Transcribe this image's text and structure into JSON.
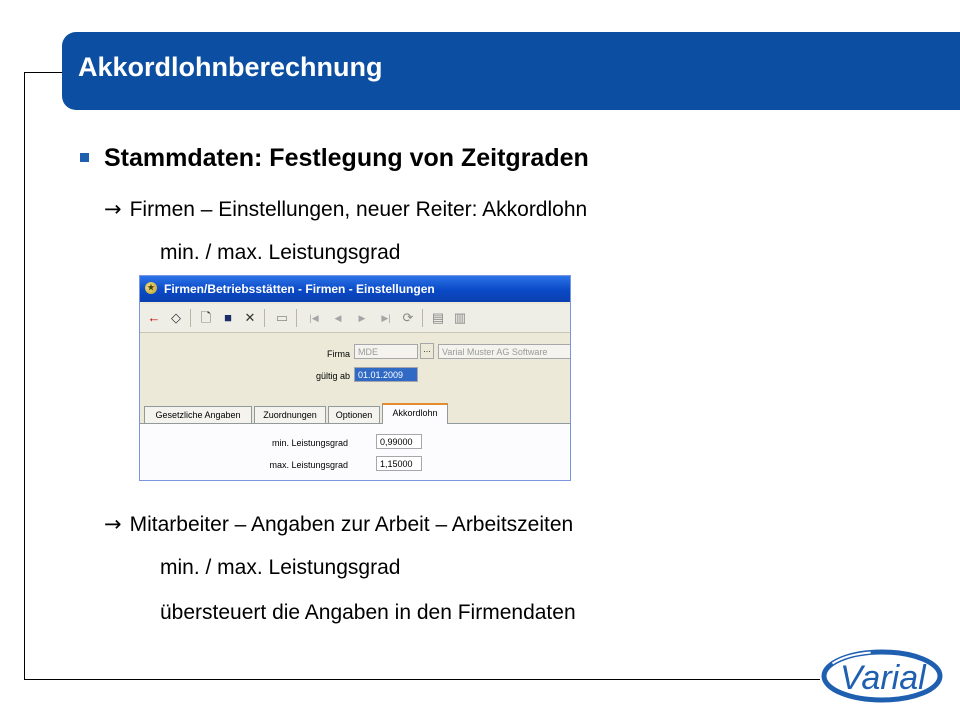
{
  "slide": {
    "title": "Akkordlohnberechnung",
    "heading": "Stammdaten: Festlegung von Zeitgraden",
    "line1": "Firmen – Einstellungen, neuer Reiter: Akkordlohn",
    "line2": "min. / max. Leistungsgrad",
    "line3": "Mitarbeiter – Angaben zur Arbeit – Arbeitszeiten",
    "line4": "min. / max. Leistungsgrad",
    "line5": "übersteuert die Angaben in den Firmendaten",
    "arrow_glyph": "→"
  },
  "window": {
    "title": "Firmen/Betriebsstätten - Firmen - Einstellungen",
    "icons": [
      "back-arrow-icon",
      "eraser-icon",
      "new-document-icon",
      "save-icon",
      "delete-icon",
      "print-icon",
      "first-record-icon",
      "previous-record-icon",
      "next-record-icon",
      "last-record-icon",
      "refresh-icon",
      "print-preview-icon",
      "print-setup-icon"
    ],
    "firma_label": "Firma",
    "firma_value": "MDE",
    "firma_name": "Varial  Muster AG Software",
    "gueltig_label": "gültig ab",
    "gueltig_value": "01.01.2009",
    "tabs": [
      {
        "label": "Gesetzliche Angaben"
      },
      {
        "label": "Zuordnungen"
      },
      {
        "label": "Optionen"
      },
      {
        "label": "Akkordlohn"
      }
    ],
    "active_tab": "Akkordlohn",
    "min_label": "min. Leistungsgrad",
    "min_value": "0,99000",
    "max_label": "max. Leistungsgrad",
    "max_value": "1,15000"
  },
  "logo": {
    "text": "Varial"
  },
  "colors": {
    "title_bar": "#0b4ea2",
    "accent": "#1f5fb0"
  }
}
